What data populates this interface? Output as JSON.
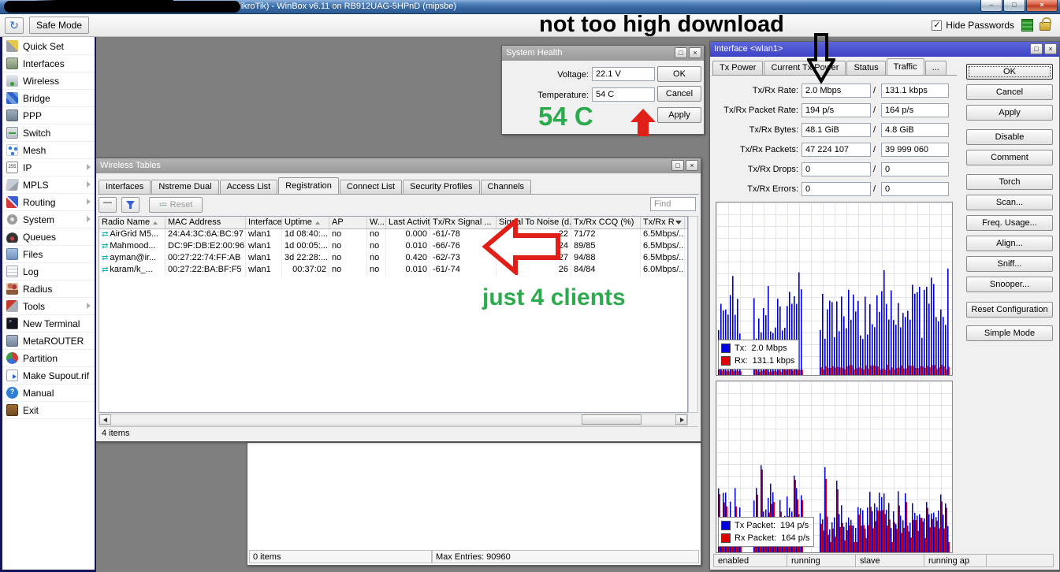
{
  "window": {
    "title": "(MikroTik) - WinBox v6.11 on RB912UAG-5HPnD (mipsbe)"
  },
  "icons": {
    "minimize": "–",
    "restore": "□",
    "close_main": "×",
    "maximize": "□",
    "close": "×",
    "undo": "↻",
    "check": "✓",
    "client": "⇄"
  },
  "toolbar": {
    "safe_mode_label": "Safe Mode",
    "hide_passwords_label": "Hide Passwords"
  },
  "sidebar": {
    "items": [
      {
        "label": "Quick Set",
        "icon": "wand-icon",
        "submenu": false
      },
      {
        "label": "Interfaces",
        "icon": "interfaces-icon",
        "submenu": false
      },
      {
        "label": "Wireless",
        "icon": "wireless-icon",
        "submenu": false
      },
      {
        "label": "Bridge",
        "icon": "bridge-icon",
        "submenu": false
      },
      {
        "label": "PPP",
        "icon": "ppp-icon",
        "submenu": false
      },
      {
        "label": "Switch",
        "icon": "switch-icon",
        "submenu": false
      },
      {
        "label": "Mesh",
        "icon": "mesh-icon",
        "submenu": false
      },
      {
        "label": "IP",
        "icon": "ip-icon",
        "submenu": true
      },
      {
        "label": "MPLS",
        "icon": "mpls-icon",
        "submenu": true
      },
      {
        "label": "Routing",
        "icon": "routing-icon",
        "submenu": true
      },
      {
        "label": "System",
        "icon": "system-icon",
        "submenu": true
      },
      {
        "label": "Queues",
        "icon": "queues-icon",
        "submenu": false
      },
      {
        "label": "Files",
        "icon": "files-icon",
        "submenu": false
      },
      {
        "label": "Log",
        "icon": "log-icon",
        "submenu": false
      },
      {
        "label": "Radius",
        "icon": "radius-icon",
        "submenu": false
      },
      {
        "label": "Tools",
        "icon": "tools-icon",
        "submenu": true
      },
      {
        "label": "New Terminal",
        "icon": "terminal-icon",
        "submenu": false
      },
      {
        "label": "MetaROUTER",
        "icon": "metarouter-icon",
        "submenu": false
      },
      {
        "label": "Partition",
        "icon": "partition-icon",
        "submenu": false
      },
      {
        "label": "Make Supout.rif",
        "icon": "supout-icon",
        "submenu": false
      },
      {
        "label": "Manual",
        "icon": "manual-icon",
        "submenu": false
      },
      {
        "label": "Exit",
        "icon": "exit-icon",
        "submenu": false
      }
    ]
  },
  "system_health": {
    "title": "System Health",
    "voltage_label": "Voltage:",
    "voltage_value": "22.1 V",
    "temperature_label": "Temperature:",
    "temperature_value": "54 C",
    "ok_label": "OK",
    "cancel_label": "Cancel",
    "apply_label": "Apply"
  },
  "wireless_tables": {
    "title": "Wireless Tables",
    "tabs": [
      "Interfaces",
      "Nstreme Dual",
      "Access List",
      "Registration",
      "Connect List",
      "Security Profiles",
      "Channels"
    ],
    "active_tab": "Registration",
    "toolbar": {
      "minus_label": "—",
      "reset_label": "Reset",
      "find_label": "Find"
    },
    "table": {
      "columns": [
        {
          "label": "Radio Name",
          "sort": true
        },
        {
          "label": "MAC Address"
        },
        {
          "label": "Interface"
        },
        {
          "label": "Uptime",
          "sort": true,
          "align": "right"
        },
        {
          "label": "AP"
        },
        {
          "label": "W..."
        },
        {
          "label": "Last Activit...",
          "align": "right"
        },
        {
          "label": "Tx/Rx Signal ..."
        },
        {
          "label": "Signal To Noise (d...",
          "align": "right"
        },
        {
          "label": "Tx/Rx CCQ (%)"
        },
        {
          "label": "Tx/Rx R",
          "filter": true
        }
      ],
      "rows": [
        [
          "AirGrid M5...",
          "24:A4:3C:6A:BC:97",
          "wlan1",
          "1d 08:40:...",
          "no",
          "no",
          "0.000",
          "-61/-78",
          "22",
          "71/72",
          "6.5Mbps/..."
        ],
        [
          "Mahmood...",
          "DC:9F:DB:E2:00:96",
          "wlan1",
          "1d 00:05:...",
          "no",
          "no",
          "0.010",
          "-66/-76",
          "24",
          "89/85",
          "6.5Mbps/..."
        ],
        [
          "ayman@ir...",
          "00:27:22:74:FF:AB",
          "wlan1",
          "3d 22:28:...",
          "no",
          "no",
          "0.420",
          "-62/-73",
          "27",
          "94/88",
          "6.5Mbps/..."
        ],
        [
          "karam/k_...",
          "00:27:22:BA:BF:F5",
          "wlan1",
          "00:37:02",
          "no",
          "no",
          "0.010",
          "-61/-74",
          "26",
          "84/84",
          "6.0Mbps/..."
        ]
      ]
    },
    "status": "4 items"
  },
  "background_window": {
    "items_status": "0 items",
    "max_entries": "Max Entries: 90960"
  },
  "interface_window": {
    "title": "Interface <wlan1>",
    "tabs": [
      "Tx Power",
      "Current Tx Power",
      "Status",
      "Traffic",
      "..."
    ],
    "active_tab": "Traffic",
    "stats": [
      {
        "label": "Tx/Rx Rate:",
        "tx": "2.0 Mbps",
        "rx": "131.1 kbps"
      },
      {
        "label": "Tx/Rx Packet Rate:",
        "tx": "194 p/s",
        "rx": "164 p/s"
      },
      {
        "label": "Tx/Rx Bytes:",
        "tx": "48.1 GiB",
        "rx": "4.8 GiB"
      },
      {
        "label": "Tx/Rx Packets:",
        "tx": "47 224 107",
        "rx": "39 999 060"
      },
      {
        "label": "Tx/Rx Drops:",
        "tx": "0",
        "rx": "0"
      },
      {
        "label": "Tx/Rx Errors:",
        "tx": "0",
        "rx": "0"
      }
    ],
    "graph1_legend": [
      {
        "name": "tx",
        "color": "#0000e0",
        "label": "Tx:",
        "value": "2.0 Mbps"
      },
      {
        "name": "rx",
        "color": "#e00000",
        "label": "Rx:",
        "value": "131.1 kbps"
      }
    ],
    "graph2_legend": [
      {
        "name": "tx-packet",
        "color": "#0000e0",
        "label": "Tx Packet:",
        "value": "194 p/s"
      },
      {
        "name": "rx-packet",
        "color": "#e00000",
        "label": "Rx Packet:",
        "value": "164 p/s"
      }
    ],
    "buttons": [
      "OK",
      "Cancel",
      "Apply",
      "Disable",
      "Comment",
      "Torch",
      "Scan...",
      "Freq. Usage...",
      "Align...",
      "Sniff...",
      "Snooper...",
      "Reset Configuration",
      "Simple Mode"
    ],
    "status_cells": [
      "enabled",
      "running",
      "slave",
      "running ap",
      ""
    ]
  },
  "annotations": {
    "download_note": "not too high download",
    "temperature_note": "54 C",
    "clients_note": "just 4 clients"
  },
  "colors": {
    "annotation_green": "#2eaa4e",
    "annotation_red": "#e02018",
    "tx_blue": "#0000d0",
    "rx_red": "#e00000"
  }
}
